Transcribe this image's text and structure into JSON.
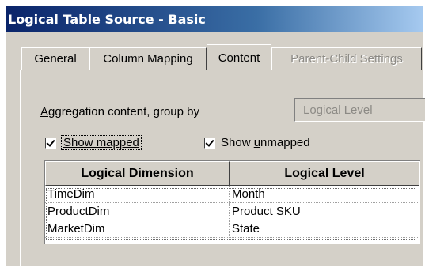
{
  "window": {
    "title": "Logical Table Source - Basic"
  },
  "tabs": [
    {
      "label": "General",
      "active": false,
      "enabled": true
    },
    {
      "label": "Column Mapping",
      "active": false,
      "enabled": true
    },
    {
      "label": "Content",
      "active": true,
      "enabled": true
    },
    {
      "label": "Parent-Child Settings",
      "active": false,
      "enabled": false
    }
  ],
  "content": {
    "aggregation_label_accel": "A",
    "aggregation_label_rest": "ggregation content, group by",
    "aggregation_value": "Logical Level",
    "show_mapped": {
      "label": "Show mapped",
      "checked": true
    },
    "show_unmapped": {
      "label_prefix": "Show ",
      "label_accel": "u",
      "label_rest": "nmapped",
      "checked": true
    }
  },
  "grid": {
    "headers": [
      "Logical Dimension",
      "Logical Level"
    ],
    "rows": [
      [
        "TimeDim",
        "Month"
      ],
      [
        "ProductDim",
        "Product SKU"
      ],
      [
        "MarketDim",
        "State"
      ]
    ]
  }
}
